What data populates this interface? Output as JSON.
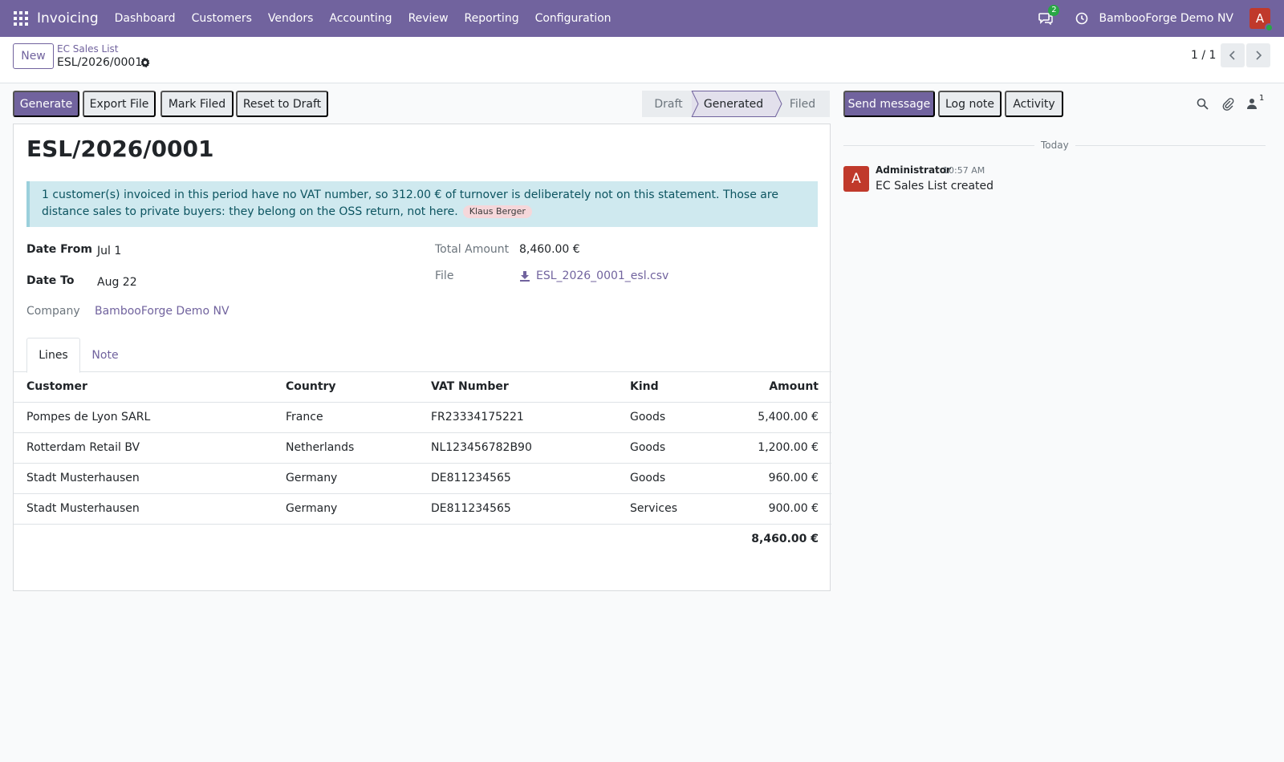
{
  "navbar": {
    "app_name": "Invoicing",
    "menu": [
      "Dashboard",
      "Customers",
      "Vendors",
      "Accounting",
      "Review",
      "Reporting",
      "Configuration"
    ],
    "chat_badge": "2",
    "company": "BambooForge Demo NV",
    "avatar_letter": "A"
  },
  "control_panel": {
    "new_label": "New",
    "breadcrumb": "EC Sales List",
    "record_name": "ESL/2026/0001",
    "pager": "1 / 1"
  },
  "actions": {
    "generate": "Generate",
    "export": "Export File",
    "mark_filed": "Mark Filed",
    "reset": "Reset to Draft"
  },
  "status": {
    "steps": [
      "Draft",
      "Generated",
      "Filed"
    ],
    "current": "Generated"
  },
  "form": {
    "title": "ESL/2026/0001",
    "alert_text": "1 customer(s) invoiced in this period have no VAT number, so 312.00 € of turnover is deliberately not on this statement. Those are distance sales to private buyers: they belong on the OSS return, not here.",
    "alert_tag": "Klaus Berger",
    "date_from_label": "Date From",
    "date_from": "Jul 1",
    "date_to_label": "Date To",
    "date_to": "Aug 22",
    "company_label": "Company",
    "company": "BambooForge Demo NV",
    "total_label": "Total Amount",
    "total": "8,460.00 €",
    "file_label": "File",
    "file": "ESL_2026_0001_esl.csv"
  },
  "tabs": [
    "Lines",
    "Note"
  ],
  "table": {
    "headers": [
      "Customer",
      "Country",
      "VAT Number",
      "Kind",
      "Amount"
    ],
    "rows": [
      [
        "Pompes de Lyon SARL",
        "France",
        "FR23334175221",
        "Goods",
        "5,400.00 €"
      ],
      [
        "Rotterdam Retail BV",
        "Netherlands",
        "NL123456782B90",
        "Goods",
        "1,200.00 €"
      ],
      [
        "Stadt Musterhausen",
        "Germany",
        "DE811234565",
        "Goods",
        "960.00 €"
      ],
      [
        "Stadt Musterhausen",
        "Germany",
        "DE811234565",
        "Services",
        "900.00 €"
      ]
    ],
    "total": "8,460.00 €"
  },
  "chatter": {
    "send_message": "Send message",
    "log_note": "Log note",
    "activity": "Activity",
    "follower_count": "1",
    "today": "Today",
    "message": {
      "avatar_letter": "A",
      "author": "Administrator",
      "time": "10:57 AM",
      "body": "EC Sales List created"
    }
  },
  "colors": {
    "brand": "#71639e",
    "alert_bg": "#cfe9ef",
    "avatar": "#c0392b",
    "online": "#28a745"
  }
}
